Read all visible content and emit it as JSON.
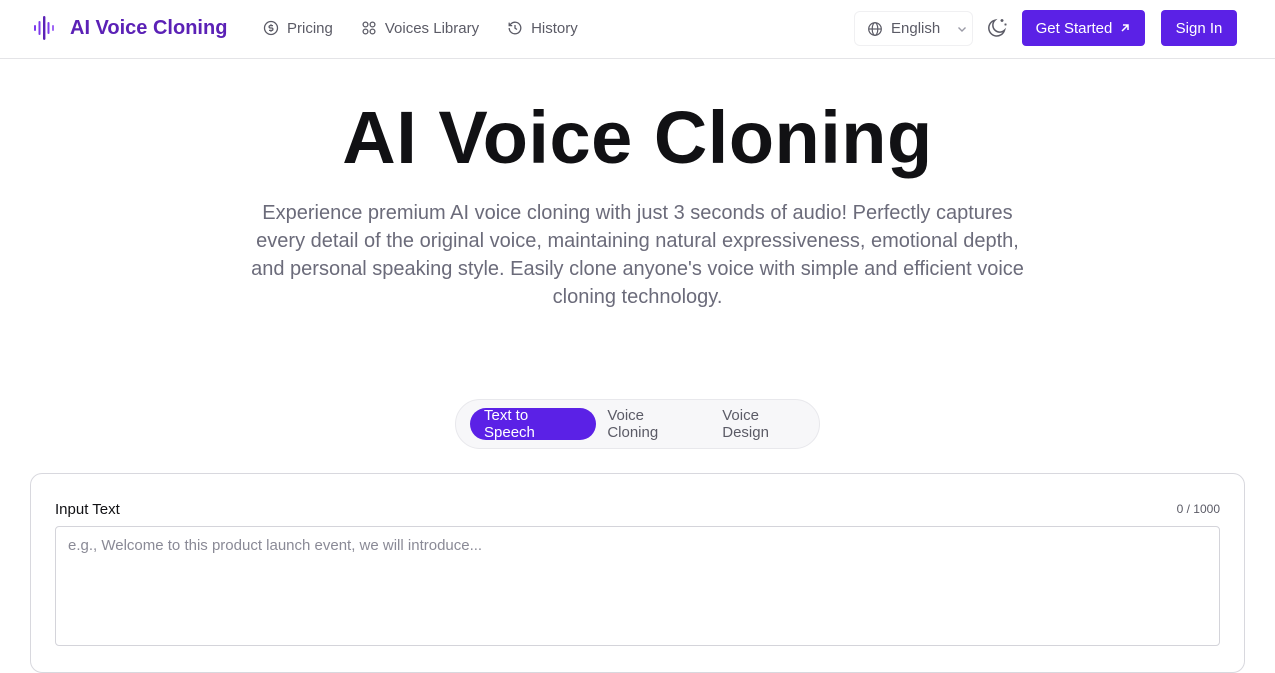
{
  "brand": {
    "name": "AI Voice Cloning",
    "logo_icon": "audio-waveform-icon",
    "color": "#5b21b6"
  },
  "nav": {
    "items": [
      {
        "label": "Pricing",
        "icon": "dollar-circle-icon"
      },
      {
        "label": "Voices Library",
        "icon": "grid-circles-icon"
      },
      {
        "label": "History",
        "icon": "history-icon"
      }
    ]
  },
  "language": {
    "selected": "English",
    "icon": "globe-icon"
  },
  "header_buttons": {
    "get_started": "Get Started",
    "sign_in": "Sign In",
    "accent": "#5b21e6"
  },
  "hero": {
    "title": "AI Voice Cloning",
    "subtitle": "Experience premium AI voice cloning with just 3 seconds of audio! Perfectly captures every detail of the original voice, maintaining natural expressiveness, emotional depth, and personal speaking style. Easily clone anyone's voice with simple and efficient voice cloning technology."
  },
  "tabs": [
    {
      "label": "Text to Speech",
      "active": true
    },
    {
      "label": "Voice Cloning",
      "active": false
    },
    {
      "label": "Voice Design",
      "active": false
    }
  ],
  "input": {
    "label": "Input Text",
    "count": "0 / 1000",
    "value": "",
    "placeholder": "e.g., Welcome to this product launch event, we will introduce..."
  }
}
